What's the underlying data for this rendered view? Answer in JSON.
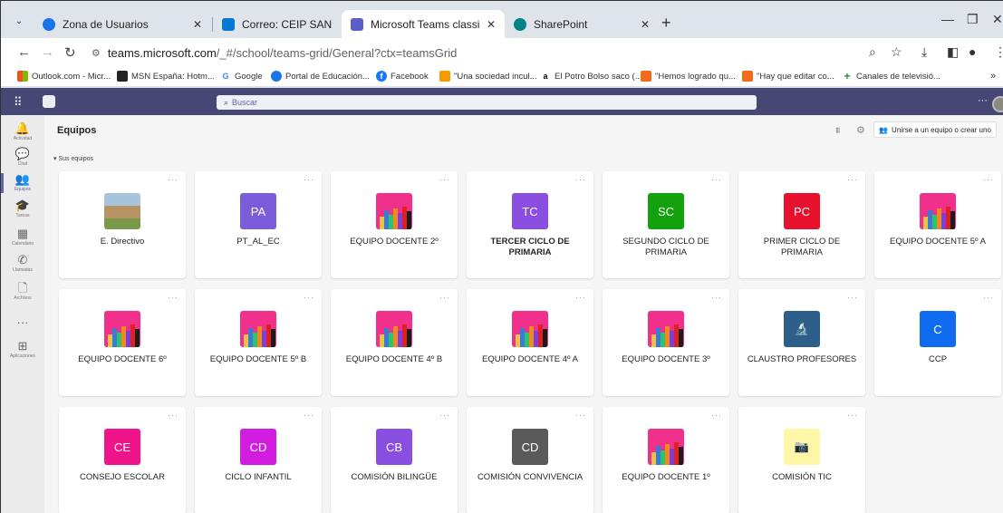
{
  "browser": {
    "tabs": [
      {
        "title": "Zona de Usuarios",
        "favicon_color": "#1a73e8"
      },
      {
        "title": "Correo: CEIP SAN BLAS - Outlo",
        "favicon_color": "#0078d4"
      },
      {
        "title": "Microsoft Teams classic",
        "favicon_color": "#5b5fc7"
      },
      {
        "title": "SharePoint",
        "favicon_color": "#038387"
      }
    ],
    "tab_close": "✕",
    "new_tab": "+",
    "url_host": "teams.microsoft.com",
    "url_path": "/_#/school/teams-grid/General?ctx=teamsGrid",
    "bookmarks": [
      {
        "label": "Outlook.com - Micr...",
        "icon_color": "#f25022"
      },
      {
        "label": "MSN España: Hotm...",
        "icon_color": "#222222"
      },
      {
        "label": "Google",
        "icon_color": "#ffffff"
      },
      {
        "label": "Portal de Educación...",
        "icon_color": "#1a73e8"
      },
      {
        "label": "Facebook",
        "icon_color": "#1877f2"
      },
      {
        "label": "\"Una sociedad incul...",
        "icon_color": "#f59b00"
      },
      {
        "label": "El Potro Bolso saco (...",
        "icon_color": "#ffffff"
      },
      {
        "label": "\"Hemos logrado qu...",
        "icon_color": "#f26b1d"
      },
      {
        "label": "\"Hay que editar co...",
        "icon_color": "#f26b1d"
      },
      {
        "label": "Canales de televisió...",
        "icon_color": "#2a8a4a"
      }
    ],
    "bookmarks_overflow": "»"
  },
  "teams": {
    "search_placeholder": "Buscar",
    "more": "···",
    "rail": [
      {
        "label": "Actividad",
        "icon": "bell-icon",
        "glyph": "🔔"
      },
      {
        "label": "Chat",
        "icon": "chat-icon",
        "glyph": "💬"
      },
      {
        "label": "Equipos",
        "icon": "teams-icon",
        "glyph": "👥"
      },
      {
        "label": "Tareas",
        "icon": "assignments-icon",
        "glyph": "🎓"
      },
      {
        "label": "Calendario",
        "icon": "calendar-icon",
        "glyph": "▦"
      },
      {
        "label": "Llamadas",
        "icon": "phone-icon",
        "glyph": "✆"
      },
      {
        "label": "Archivos",
        "icon": "files-icon",
        "glyph": "🗋"
      },
      {
        "label": "",
        "icon": "more-apps-icon",
        "glyph": "···"
      },
      {
        "label": "Aplicaciones",
        "icon": "apps-icon",
        "glyph": "⊞"
      }
    ],
    "page_title": "Equipos",
    "join_label": "Unirse a un equipo o crear uno",
    "section_label": "Sus equipos",
    "card_menu": "···",
    "cards": [
      {
        "name": "E. Directivo",
        "avatar": "photo",
        "initials": ""
      },
      {
        "name": "PT_AL_EC",
        "avatar": "initials",
        "initials": "PA",
        "color": "#7b5cdb"
      },
      {
        "name": "EQUIPO DOCENTE 2º",
        "avatar": "pencils",
        "initials": ""
      },
      {
        "name": "TERCER CICLO DE PRIMARIA",
        "avatar": "initials",
        "initials": "TC",
        "color": "#8a4fe0",
        "bold": true
      },
      {
        "name": "SEGUNDO CICLO DE PRIMARIA",
        "avatar": "initials",
        "initials": "SC",
        "color": "#13a10e"
      },
      {
        "name": "PRIMER CICLO DE PRIMARIA",
        "avatar": "initials",
        "initials": "PC",
        "color": "#e8112d"
      },
      {
        "name": "EQUIPO DOCENTE 5º A",
        "avatar": "pencils",
        "initials": ""
      },
      {
        "name": "EQUIPO DOCENTE 6º",
        "avatar": "pencils",
        "initials": ""
      },
      {
        "name": "EQUIPO DOCENTE 5º B",
        "avatar": "pencils",
        "initials": ""
      },
      {
        "name": "EQUIPO DOCENTE 4º B",
        "avatar": "pencils",
        "initials": ""
      },
      {
        "name": "EQUIPO DOCENTE 4º A",
        "avatar": "pencils",
        "initials": ""
      },
      {
        "name": "EQUIPO DOCENTE 3º",
        "avatar": "pencils",
        "initials": ""
      },
      {
        "name": "CLAUSTRO PROFESORES",
        "avatar": "micro",
        "initials": ""
      },
      {
        "name": "CCP",
        "avatar": "initials",
        "initials": "C",
        "color": "#0f6cf0"
      },
      {
        "name": "CONSEJO ESCOLAR",
        "avatar": "initials",
        "initials": "CE",
        "color": "#f0148a"
      },
      {
        "name": "CICLO INFANTIL",
        "avatar": "initials",
        "initials": "CD",
        "color": "#d21ce0"
      },
      {
        "name": "COMISIÓN BILINGÜE",
        "avatar": "initials",
        "initials": "CB",
        "color": "#8a4fe0"
      },
      {
        "name": "COMISIÓN CONVIVENCIA",
        "avatar": "initials",
        "initials": "CD",
        "color": "#5a5a5a"
      },
      {
        "name": "EQUIPO DOCENTE 1º",
        "avatar": "pencils",
        "initials": ""
      },
      {
        "name": "COMISIÓN TIC",
        "avatar": "camera",
        "initials": ""
      }
    ]
  }
}
